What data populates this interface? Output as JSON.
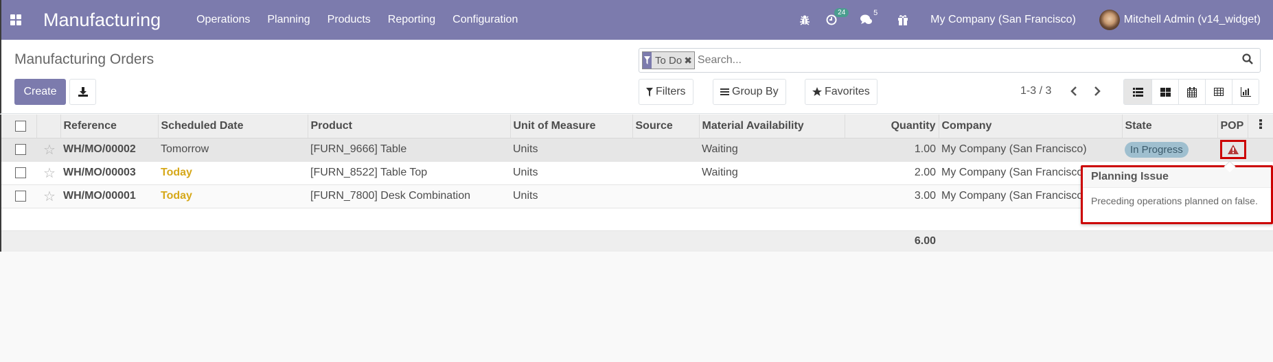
{
  "navbar": {
    "app_name": "Manufacturing",
    "menu": [
      "Operations",
      "Planning",
      "Products",
      "Reporting",
      "Configuration"
    ],
    "activity_count": "24",
    "messages_count": "5",
    "company": "My Company (San Francisco)",
    "user": "Mitchell Admin (v14_widget)",
    "icons": [
      "apps-icon",
      "debug-bug-icon",
      "activity-clock-icon",
      "chat-icon",
      "gift-icon",
      "avatar"
    ]
  },
  "control_panel": {
    "title": "Manufacturing Orders",
    "create_label": "Create",
    "search": {
      "facet_label": "To Do",
      "placeholder": "Search..."
    },
    "filters_label": "Filters",
    "group_by_label": "Group By",
    "favorites_label": "Favorites",
    "pager": "1-3 / 3",
    "views": [
      "list",
      "kanban",
      "calendar",
      "pivot",
      "graph"
    ],
    "active_view": "list"
  },
  "table": {
    "columns": [
      "Reference",
      "Scheduled Date",
      "Product",
      "Unit of Measure",
      "Source",
      "Material Availability",
      "Quantity",
      "Company",
      "State",
      "POP"
    ],
    "rows": [
      {
        "reference": "WH/MO/00002",
        "scheduled_date": "Tomorrow",
        "date_highlight": false,
        "product": "[FURN_9666] Table",
        "uom": "Units",
        "source": "",
        "availability": "Waiting",
        "quantity": "1.00",
        "company": "My Company (San Francisco)",
        "state": "In Progress",
        "pop_warning": true
      },
      {
        "reference": "WH/MO/00003",
        "scheduled_date": "Today",
        "date_highlight": true,
        "product": "[FURN_8522] Table Top",
        "uom": "Units",
        "source": "",
        "availability": "Waiting",
        "quantity": "2.00",
        "company": "My Company (San Francisco)",
        "state": "",
        "pop_warning": false
      },
      {
        "reference": "WH/MO/00001",
        "scheduled_date": "Today",
        "date_highlight": true,
        "product": "[FURN_7800] Desk Combination",
        "uom": "Units",
        "source": "",
        "availability": "",
        "quantity": "3.00",
        "company": "My Company (San Francisco)",
        "state": "",
        "pop_warning": false
      }
    ],
    "total_quantity": "6.00"
  },
  "tooltip": {
    "title": "Planning Issue",
    "body": "Preceding operations planned on false."
  },
  "colors": {
    "brand": "#7c7bad",
    "today": "#d6a819",
    "state_badge": "#9fbfcf",
    "highlight_red": "#cc0000",
    "warning_icon": "#b33a3a"
  }
}
